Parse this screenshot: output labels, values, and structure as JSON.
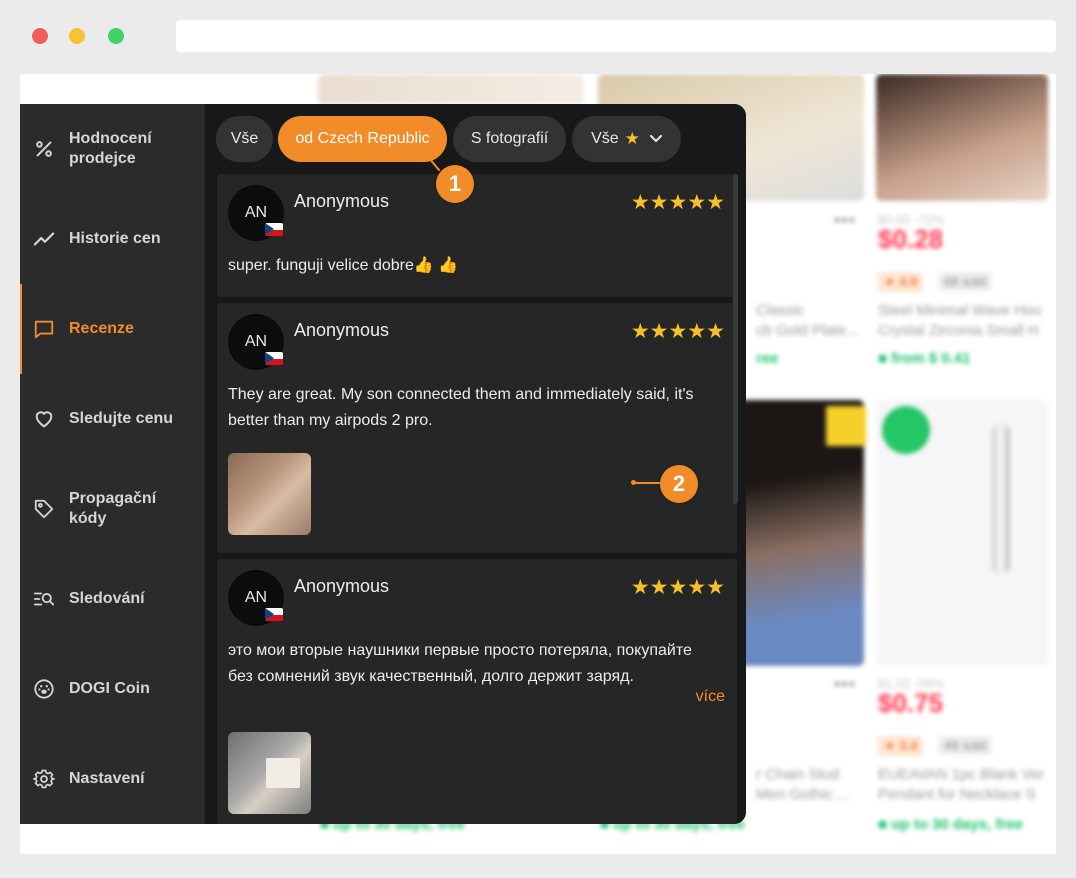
{
  "sidebar": {
    "items": [
      {
        "label": "Hodnocení prodejce",
        "icon": "percent-icon"
      },
      {
        "label": "Historie cen",
        "icon": "chart-line-icon"
      },
      {
        "label": "Recenze",
        "icon": "chat-bubble-icon"
      },
      {
        "label": "Sledujte cenu",
        "icon": "heart-icon"
      },
      {
        "label": "Propagační kódy",
        "icon": "tag-icon"
      },
      {
        "label": "Sledování",
        "icon": "list-search-icon"
      },
      {
        "label": "DOGI Coin",
        "icon": "coin-icon"
      },
      {
        "label": "Nastavení",
        "icon": "gear-icon"
      }
    ],
    "active_index": 2
  },
  "filters": {
    "all": "Vše",
    "country": "od Czech Republic",
    "photos": "S fotografií",
    "rating": "Vše",
    "active": "country"
  },
  "reviews": [
    {
      "initials": "AN",
      "author": "Anonymous",
      "stars": "★★★★★",
      "text": "super. funguji velice dobre👍 👍",
      "has_photo": false
    },
    {
      "initials": "AN",
      "author": "Anonymous",
      "stars": "★★★★★",
      "text": "They are great. My son connected them and immediately said, it's better than my airpods 2 pro.",
      "has_photo": true
    },
    {
      "initials": "AN",
      "author": "Anonymous",
      "stars": "★★★★★",
      "text": "это мои вторые наушники первые просто потеряла, покупайте без сомнений звук качественный, долго держит заряд.",
      "more": "více",
      "has_photo": true
    }
  ],
  "callouts": {
    "one": "1",
    "two": "2"
  },
  "colors": {
    "accent": "#f28c28",
    "star": "#f6c02a",
    "panel_bg": "#161819",
    "sidebar_bg": "#2b2b2b",
    "card_bg": "#262626"
  }
}
